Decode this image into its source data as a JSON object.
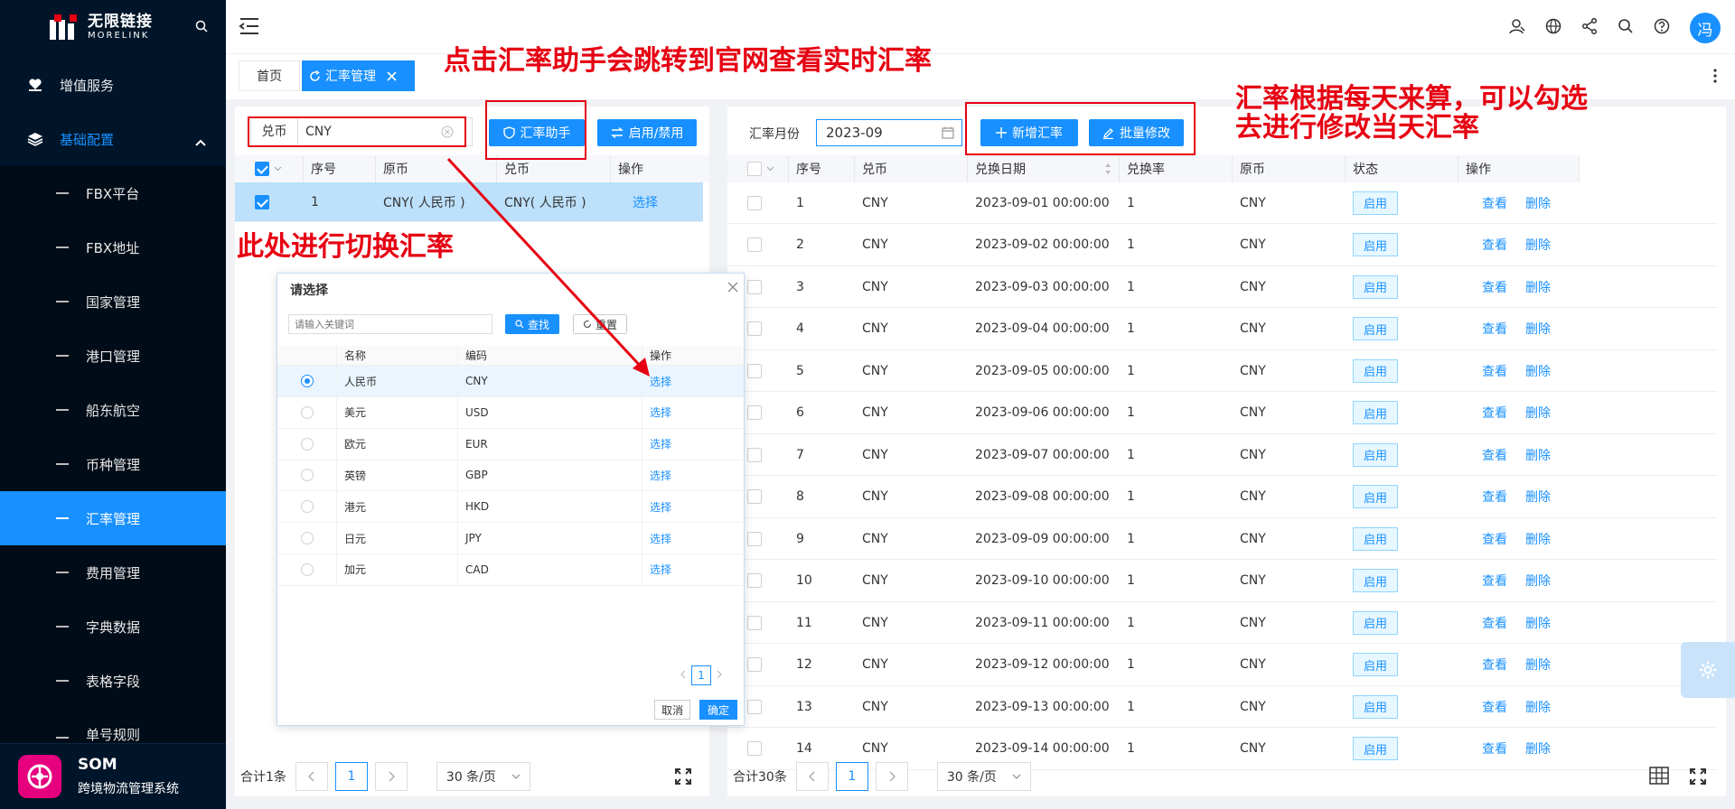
{
  "sidebar": {
    "logo_cn": "无限链接",
    "logo_en": "MORELINK",
    "menu": [
      {
        "label": "增值服务",
        "icon": "heart-hand-icon"
      },
      {
        "label": "基础配置",
        "icon": "layers-icon"
      }
    ],
    "sub_items": [
      "FBX平台",
      "FBX地址",
      "国家管理",
      "港口管理",
      "船东航空",
      "币种管理",
      "汇率管理",
      "费用管理",
      "字典数据",
      "表格字段",
      "单号规则"
    ],
    "active_item": "汇率管理",
    "footer_title": "SOM",
    "footer_subtitle": "跨境物流管理系统"
  },
  "topbar": {
    "avatar_text": "冯",
    "icons": [
      "user-switch-icon",
      "globe-icon",
      "share-icon",
      "search-icon",
      "help-icon"
    ]
  },
  "tabs": {
    "home": "首页",
    "current": "汇率管理"
  },
  "left_panel": {
    "filter_label": "兑币",
    "filter_value": "CNY",
    "btn_helper": "汇率助手",
    "btn_toggle": "启用/禁用",
    "columns": [
      "序号",
      "原币",
      "兑币",
      "操作"
    ],
    "rows": [
      {
        "index": "1",
        "from": "CNY( 人民币 )",
        "to": "CNY( 人民币 )",
        "action": "选择"
      }
    ],
    "total": "合计1条",
    "page": "1",
    "page_size": "30 条/页"
  },
  "right_panel": {
    "month_label": "汇率月份",
    "month_value": "2023-09",
    "btn_add": "新增汇率",
    "btn_batch": "批量修改",
    "columns": [
      "序号",
      "兑币",
      "兑换日期",
      "兑换率",
      "原币",
      "状态",
      "操作"
    ],
    "rows": [
      {
        "index": "1",
        "to": "CNY",
        "date": "2023-09-01 00:00:00",
        "rate": "1",
        "from": "CNY",
        "status": "启用",
        "view": "查看",
        "del": "删除"
      },
      {
        "index": "2",
        "to": "CNY",
        "date": "2023-09-02 00:00:00",
        "rate": "1",
        "from": "CNY",
        "status": "启用",
        "view": "查看",
        "del": "删除"
      },
      {
        "index": "3",
        "to": "CNY",
        "date": "2023-09-03 00:00:00",
        "rate": "1",
        "from": "CNY",
        "status": "启用",
        "view": "查看",
        "del": "删除"
      },
      {
        "index": "4",
        "to": "CNY",
        "date": "2023-09-04 00:00:00",
        "rate": "1",
        "from": "CNY",
        "status": "启用",
        "view": "查看",
        "del": "删除"
      },
      {
        "index": "5",
        "to": "CNY",
        "date": "2023-09-05 00:00:00",
        "rate": "1",
        "from": "CNY",
        "status": "启用",
        "view": "查看",
        "del": "删除"
      },
      {
        "index": "6",
        "to": "CNY",
        "date": "2023-09-06 00:00:00",
        "rate": "1",
        "from": "CNY",
        "status": "启用",
        "view": "查看",
        "del": "删除"
      },
      {
        "index": "7",
        "to": "CNY",
        "date": "2023-09-07 00:00:00",
        "rate": "1",
        "from": "CNY",
        "status": "启用",
        "view": "查看",
        "del": "删除"
      },
      {
        "index": "8",
        "to": "CNY",
        "date": "2023-09-08 00:00:00",
        "rate": "1",
        "from": "CNY",
        "status": "启用",
        "view": "查看",
        "del": "删除"
      },
      {
        "index": "9",
        "to": "CNY",
        "date": "2023-09-09 00:00:00",
        "rate": "1",
        "from": "CNY",
        "status": "启用",
        "view": "查看",
        "del": "删除"
      },
      {
        "index": "10",
        "to": "CNY",
        "date": "2023-09-10 00:00:00",
        "rate": "1",
        "from": "CNY",
        "status": "启用",
        "view": "查看",
        "del": "删除"
      },
      {
        "index": "11",
        "to": "CNY",
        "date": "2023-09-11 00:00:00",
        "rate": "1",
        "from": "CNY",
        "status": "启用",
        "view": "查看",
        "del": "删除"
      },
      {
        "index": "12",
        "to": "CNY",
        "date": "2023-09-12 00:00:00",
        "rate": "1",
        "from": "CNY",
        "status": "启用",
        "view": "查看",
        "del": "删除"
      },
      {
        "index": "13",
        "to": "CNY",
        "date": "2023-09-13 00:00:00",
        "rate": "1",
        "from": "CNY",
        "status": "启用",
        "view": "查看",
        "del": "删除"
      },
      {
        "index": "14",
        "to": "CNY",
        "date": "2023-09-14 00:00:00",
        "rate": "1",
        "from": "CNY",
        "status": "启用",
        "view": "查看",
        "del": "删除"
      }
    ],
    "total": "合计30条",
    "page": "1",
    "page_size": "30 条/页"
  },
  "modal": {
    "title": "请选择",
    "search_placeholder": "请输入关键词",
    "btn_search": "查找",
    "btn_reset": "重置",
    "columns": [
      "名称",
      "编码",
      "操作"
    ],
    "rows": [
      {
        "name": "人民币",
        "code": "CNY",
        "action": "选择",
        "selected": true
      },
      {
        "name": "美元",
        "code": "USD",
        "action": "选择",
        "selected": false
      },
      {
        "name": "欧元",
        "code": "EUR",
        "action": "选择",
        "selected": false
      },
      {
        "name": "英镑",
        "code": "GBP",
        "action": "选择",
        "selected": false
      },
      {
        "name": "港元",
        "code": "HKD",
        "action": "选择",
        "selected": false
      },
      {
        "name": "日元",
        "code": "JPY",
        "action": "选择",
        "selected": false
      },
      {
        "name": "加元",
        "code": "CAD",
        "action": "选择",
        "selected": false
      }
    ],
    "page": "1",
    "btn_cancel": "取消",
    "btn_ok": "确定"
  },
  "annotations": {
    "helper_note": "点击汇率助手会跳转到官网查看实时汇率",
    "switch_note": "此处进行切换汇率",
    "daily_note_1": "汇率根据每天来算，可以勾选",
    "daily_note_2": "去进行修改当天汇率"
  },
  "colors": {
    "primary": "#1890ff",
    "sidebar_bg": "#001529",
    "annotation_red": "#e60012"
  }
}
